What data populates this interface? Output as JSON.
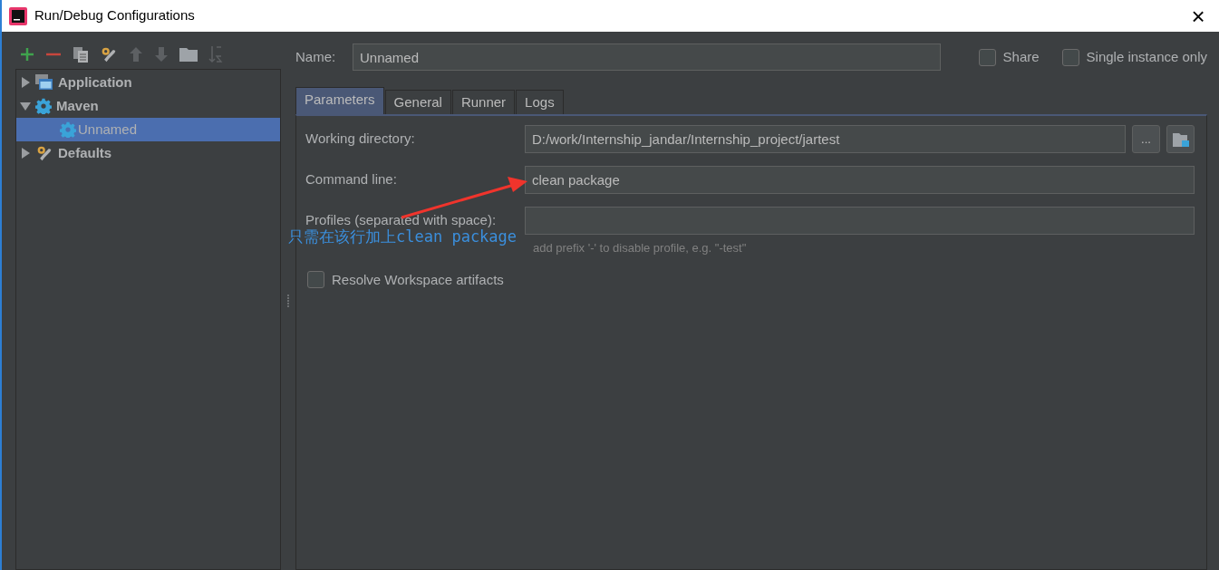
{
  "window": {
    "title": "Run/Debug Configurations",
    "close": "×"
  },
  "tree": [
    {
      "label": "Application",
      "kind": "application",
      "expanded": false,
      "selected": false
    },
    {
      "label": "Maven",
      "kind": "maven",
      "expanded": true,
      "selected": false,
      "children": [
        {
          "label": "Unnamed",
          "kind": "maven",
          "selected": true
        }
      ]
    },
    {
      "label": "Defaults",
      "kind": "defaults",
      "expanded": false,
      "selected": false
    }
  ],
  "name": {
    "label": "Name:",
    "value": "Unnamed"
  },
  "options": [
    {
      "label": "Share",
      "checked": false
    },
    {
      "label": "Single instance only",
      "checked": false
    }
  ],
  "tabs": [
    {
      "label": "Parameters",
      "selected": true
    },
    {
      "label": "General",
      "selected": false
    },
    {
      "label": "Runner",
      "selected": false
    },
    {
      "label": "Logs",
      "selected": false
    }
  ],
  "fields": [
    {
      "label": "Working directory:",
      "value": "D:/work/Internship_jandar/Internship_project/jartest",
      "browse": "..."
    },
    {
      "label": "Command line:",
      "value": "clean package"
    },
    {
      "label": "Profiles (separated with space):",
      "hint": "add prefix '-' to disable profile, e.g. \"-test\""
    }
  ],
  "resolve": {
    "label": "Resolve Workspace artifacts",
    "checked": false
  },
  "annotation": "只需在该行加上clean package"
}
